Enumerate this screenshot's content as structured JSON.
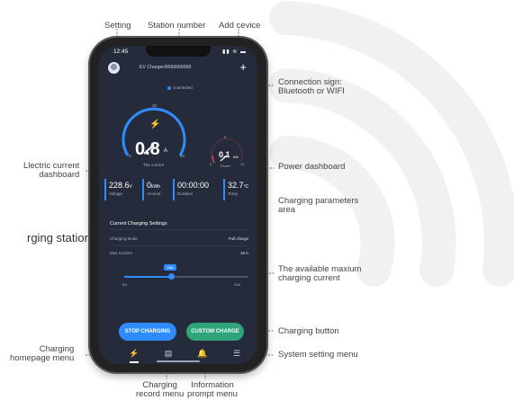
{
  "annotations": {
    "setting": "Setting",
    "station_number": "Station number",
    "add_device": "Add cevice",
    "connection_sign": "Connection sign:\nBluetooth or WIFI",
    "current_dashboard": "Llectric current\ndashboard",
    "power_dashboard": "Power dashboard",
    "charging_params_area": "Charging parameters\narea",
    "charging_stations": "rging stations",
    "max_current": "The available maxium\ncharging current",
    "charging_button": "Charging button",
    "homepage_menu": "Charging\nhomepage menu",
    "system_setting_menu": "System setting menu",
    "record_menu": "Charging\nrecord menu",
    "prompt_menu": "Information\nprompt menu"
  },
  "app": {
    "status_time": "12:45",
    "status_icons": "▮▮ ≋ ▬",
    "station_name": "EV Charger/6666666666",
    "add_label": "+",
    "connection_status": "Connected",
    "current_value": "0.8",
    "current_unit": "A",
    "current_caption": "The current",
    "current_ticks": {
      "min": "0",
      "mid": "20",
      "max": "40"
    },
    "power_value": "0.1",
    "power_unit": "kW",
    "power_caption": "Power",
    "power_ticks": {
      "min": "0",
      "mid": "5",
      "max": "10"
    },
    "parameters": [
      {
        "value": "228.6",
        "unit": "V",
        "label": "Voltage"
      },
      {
        "value": "0",
        "unit": "kWh",
        "label": "Amount"
      },
      {
        "value": "00:00:00",
        "unit": "",
        "label": "Duration"
      },
      {
        "value": "32.7",
        "unit": "°C",
        "label": "Temp"
      }
    ],
    "settings_title": "Current Charging Settings",
    "charging_mode_label": "Charging Mode",
    "charging_mode_value": "Full charge",
    "max_current_label": "Max Current",
    "max_current_value": "16 A",
    "slider_value_label": "16A",
    "slider_min_label": "6A",
    "slider_max_label": "32A",
    "slider_fraction": 0.38,
    "stop_button": "STOP CHARGING",
    "custom_button": "CUSTOM CHARGE",
    "nav": [
      "home-charge-icon",
      "record-icon",
      "bell-icon",
      "menu-icon"
    ]
  },
  "colors": {
    "screen_bg": "#252b3b",
    "accent_blue": "#2f8cff",
    "accent_green": "#2fa37a",
    "power_red": "#e0445b"
  }
}
